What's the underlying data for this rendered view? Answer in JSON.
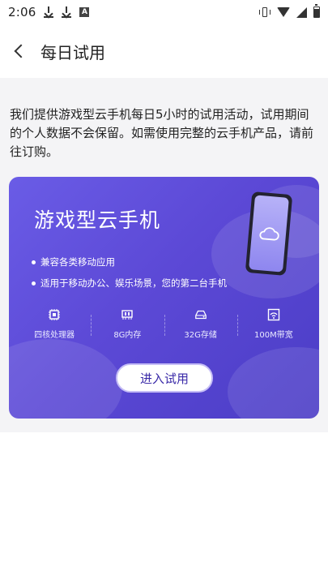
{
  "status": {
    "time": "2:06",
    "notif_letter": "A"
  },
  "header": {
    "title": "每日试用"
  },
  "description": "我们提供游戏型云手机每日5小时的试用活动，试用期间的个人数据不会保留。如需使用完整的云手机产品，请前往订购。",
  "promo": {
    "title": "游戏型云手机",
    "features": [
      "兼容各类移动应用",
      "适用于移动办公、娱乐场景，您的第二台手机"
    ],
    "specs": [
      {
        "label": "四核处理器",
        "icon": "cpu-icon"
      },
      {
        "label": "8G内存",
        "icon": "memory-icon"
      },
      {
        "label": "32G存储",
        "icon": "storage-icon"
      },
      {
        "label": "100M带宽",
        "icon": "bandwidth-icon"
      }
    ],
    "button_label": "进入试用"
  },
  "colors": {
    "card_gradient_start": "#6a5ce6",
    "card_gradient_end": "#4b3dc6",
    "button_text": "#3a2aa8"
  }
}
